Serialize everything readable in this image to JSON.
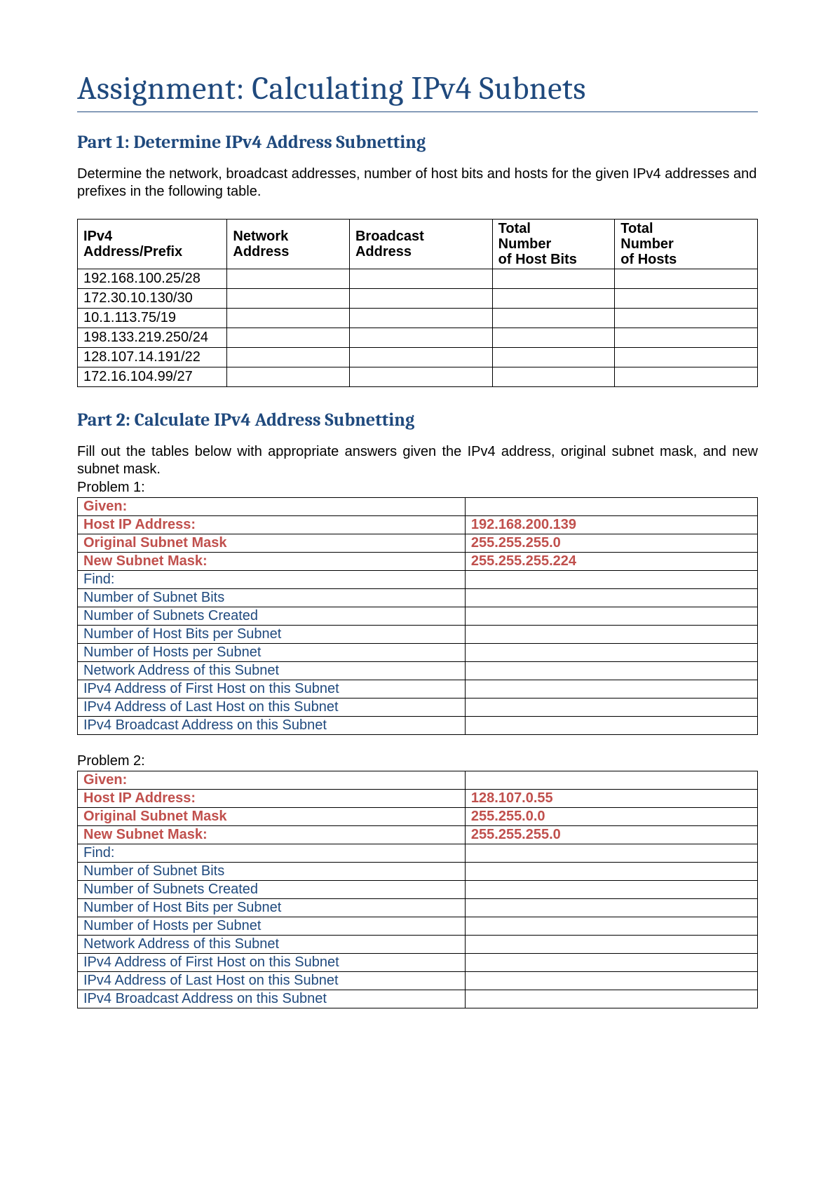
{
  "title": "Assignment: Calculating IPv4 Subnets",
  "part1": {
    "heading": "Part 1: Determine IPv4 Address Subnetting",
    "instructions": "Determine the network, broadcast addresses, number of host bits and hosts for the given IPv4 addresses and prefixes in the following table.",
    "headers": {
      "col1a": "IPv4",
      "col1b": "Address/Prefix",
      "col2a": "Network",
      "col2b": "Address",
      "col3a": "Broadcast",
      "col3b": "Address",
      "col4a": "Total",
      "col4b": "Number",
      "col4c": "of Host Bits",
      "col5a": "Total",
      "col5b": "Number",
      "col5c": "of Hosts"
    },
    "rows": [
      {
        "prefix": "192.168.100.25/28",
        "network": "",
        "broadcast": "",
        "hostbits": "",
        "hosts": ""
      },
      {
        "prefix": "172.30.10.130/30",
        "network": "",
        "broadcast": "",
        "hostbits": "",
        "hosts": ""
      },
      {
        "prefix": "10.1.113.75/19",
        "network": "",
        "broadcast": "",
        "hostbits": "",
        "hosts": ""
      },
      {
        "prefix": "198.133.219.250/24",
        "network": "",
        "broadcast": "",
        "hostbits": "",
        "hosts": ""
      },
      {
        "prefix": "128.107.14.191/22",
        "network": "",
        "broadcast": "",
        "hostbits": "",
        "hosts": ""
      },
      {
        "prefix": "172.16.104.99/27",
        "network": "",
        "broadcast": "",
        "hostbits": "",
        "hosts": ""
      }
    ]
  },
  "part2": {
    "heading": "Part 2: Calculate IPv4 Address Subnetting",
    "instructions": "Fill out the tables below with appropriate answers given the IPv4 address, original subnet mask, and new subnet mask.",
    "labels": {
      "given": "Given:",
      "host_ip": "Host IP Address:",
      "orig_mask": "Original Subnet Mask",
      "new_mask": "New Subnet Mask:",
      "find": "Find:",
      "subnet_bits": "Number of Subnet Bits",
      "subnets_created": "Number of Subnets Created",
      "host_bits": "Number of Host Bits per Subnet",
      "hosts_per": "Number of Hosts per Subnet",
      "net_addr": "Network Address of this Subnet",
      "first_host": "IPv4 Address of First Host on this Subnet",
      "last_host": "IPv4 Address of Last Host on this Subnet",
      "bcast_addr": "IPv4 Broadcast Address on this Subnet"
    },
    "problems": [
      {
        "title": "Problem 1:",
        "host_ip": "192.168.200.139",
        "orig_mask": "255.255.255.0",
        "new_mask": "255.255.255.224",
        "answers": {
          "subnet_bits": "",
          "subnets_created": "",
          "host_bits": "",
          "hosts_per": "",
          "net_addr": "",
          "first_host": "",
          "last_host": "",
          "bcast_addr": ""
        }
      },
      {
        "title": "Problem 2:",
        "host_ip": "128.107.0.55",
        "orig_mask": "255.255.0.0",
        "new_mask": "255.255.255.0",
        "answers": {
          "subnet_bits": "",
          "subnets_created": "",
          "host_bits": "",
          "hosts_per": "",
          "net_addr": "",
          "first_host": "",
          "last_host": "",
          "bcast_addr": ""
        }
      }
    ]
  }
}
